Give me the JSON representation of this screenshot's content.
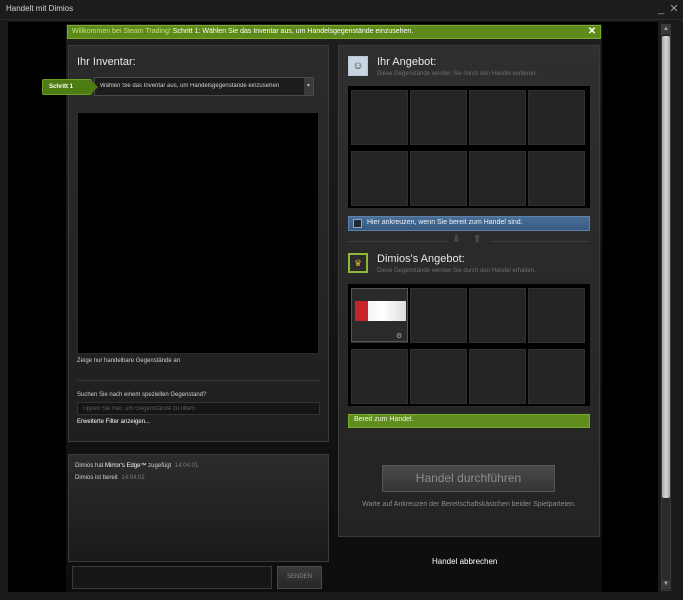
{
  "window": {
    "title": "Handelt mit Dimios",
    "minimize_glyph": "_",
    "close_glyph": "✕"
  },
  "banner": {
    "welcome": "Willkommen bei Steam Trading!",
    "step": "Schritt 1: Wählen Sie das Inventar aus, um Handelsgegenstände einzusehen.",
    "close_glyph": "✕",
    "color": "#5d8a18"
  },
  "inventory": {
    "title": "Ihr Inventar:",
    "step_badge": "Schritt 1",
    "select_value": "Wählen Sie das Inventar aus, um Handelsgegenstände einzusehen",
    "select_arrow": "▾",
    "tradable_note": "Zeige nur handelbare Gegenstände an",
    "search_label": "Suchen Sie nach einem speziellen Gegenstand?",
    "search_placeholder": "Tippen Sie hier, um Gegenstände zu filtern",
    "advanced_filter": "Erweiterte Filter anzeigen..."
  },
  "chat": {
    "line1_prefix": "Dimios hat ",
    "line1_item": "Mirror's Edge™",
    "line1_suffix": " zugefügt",
    "line1_time": "14:04:01",
    "line2_text": "Dimios ist bereit",
    "line2_time": "14:04:02",
    "input_value": "",
    "send_label": "SENDEN"
  },
  "your_offer": {
    "title": "Ihr Angebot:",
    "description": "Diese Gegenstände werden Sie durch den Handel verlieren.",
    "avatar_icon": "troll-face-avatar-icon",
    "avatar_glyph": "☺",
    "slot_count": 8,
    "ready_label": "Hier ankreuzen, wenn Sie bereit zum Handel sind.",
    "ready_checked": false
  },
  "swap": {
    "down_glyph": "⬇",
    "up_glyph": "⬆"
  },
  "their_offer": {
    "title": "Dimios's Angebot:",
    "description": "Diese Gegenstände werden Sie durch den Handel erhalten.",
    "avatar_icon": "crown-avatar-icon",
    "avatar_glyph": "♛",
    "slot_count": 8,
    "item_icon": "mirrors-edge-game-icon",
    "item_badge_glyph": "⚙",
    "status": "Bereit zum Handel."
  },
  "actions": {
    "execute_label": "Handel durchführen",
    "execute_enabled": false,
    "wait_text": "Warte auf Ankreuzen der Bereitschaftskästchen beider Spielparteien.",
    "cancel_label": "Handel abbrechen"
  },
  "scrollbar": {
    "up_glyph": "▲",
    "down_glyph": "▼"
  },
  "colors": {
    "accent_green": "#5f8e1e",
    "ready_blue": "#4a6f96",
    "panel_bg": "#2b2b2b"
  }
}
